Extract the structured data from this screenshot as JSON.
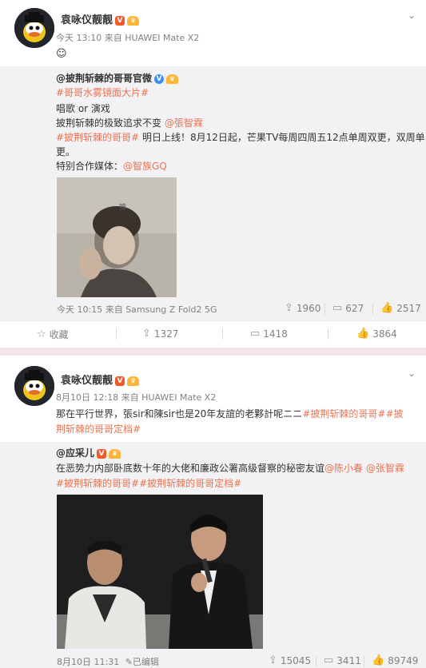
{
  "posts": [
    {
      "author": "袁咏仪靓靓",
      "meta": "今天 13:10 来自 HUAWEI Mate X2",
      "text": "☺",
      "repost": {
        "author": "@披荆斩棘的哥哥官微",
        "line1_tag": "#哥哥水雾镜面大片#",
        "line2": "唱歌 or 演戏",
        "line3_pre": "披荆斩棘的极致追求不变",
        "line3_at": "@張智霖",
        "line4_tag": "#披荆斩棘的哥哥#",
        "line4_rest": "明日上线！8月12日起，芒果TV每周四周五12点单周双更，双周单",
        "line5": "更。",
        "line6_pre": "特别合作媒体：",
        "line6_at": "@智族GQ",
        "meta": "今天 10:15 来自 Samsung Z Fold2 5G",
        "forward_count": "1960",
        "comment_count": "627",
        "like_count": "2517"
      },
      "actions": {
        "collect": "收藏",
        "forward": "1327",
        "comment": "1418",
        "like": "3864"
      }
    },
    {
      "author": "袁咏仪靓靓",
      "meta": "8月10日 12:18 来自 HUAWEI Mate X2",
      "text_pre": "那在平行世界，張sir和陳sir也是20年友誼的老夥計呢ニニ",
      "text_tag1": "#披荆斩棘的哥哥#",
      "text_tag2a": "#披",
      "text_tag2b": "荆斩棘的哥哥定档#",
      "repost": {
        "author": "@应采儿",
        "line1": "在恶势力内部卧底数十年的大佬和廉政公署高级督察的秘密友谊",
        "line1_at1": "@陈小春",
        "line1_at2": "@张智霖",
        "line2_tags": "#披荆斩棘的哥哥##披荆斩棘的哥哥定档#",
        "meta_date": "8月10日 11:31",
        "edited": "已编辑",
        "forward_count": "15045",
        "comment_count": "3411",
        "like_count": "89749"
      }
    }
  ],
  "icons": {
    "chevron": "chevron-down-icon",
    "forward": "forward-icon",
    "comment": "comment-icon",
    "like": "like-icon",
    "collect": "star-icon"
  }
}
